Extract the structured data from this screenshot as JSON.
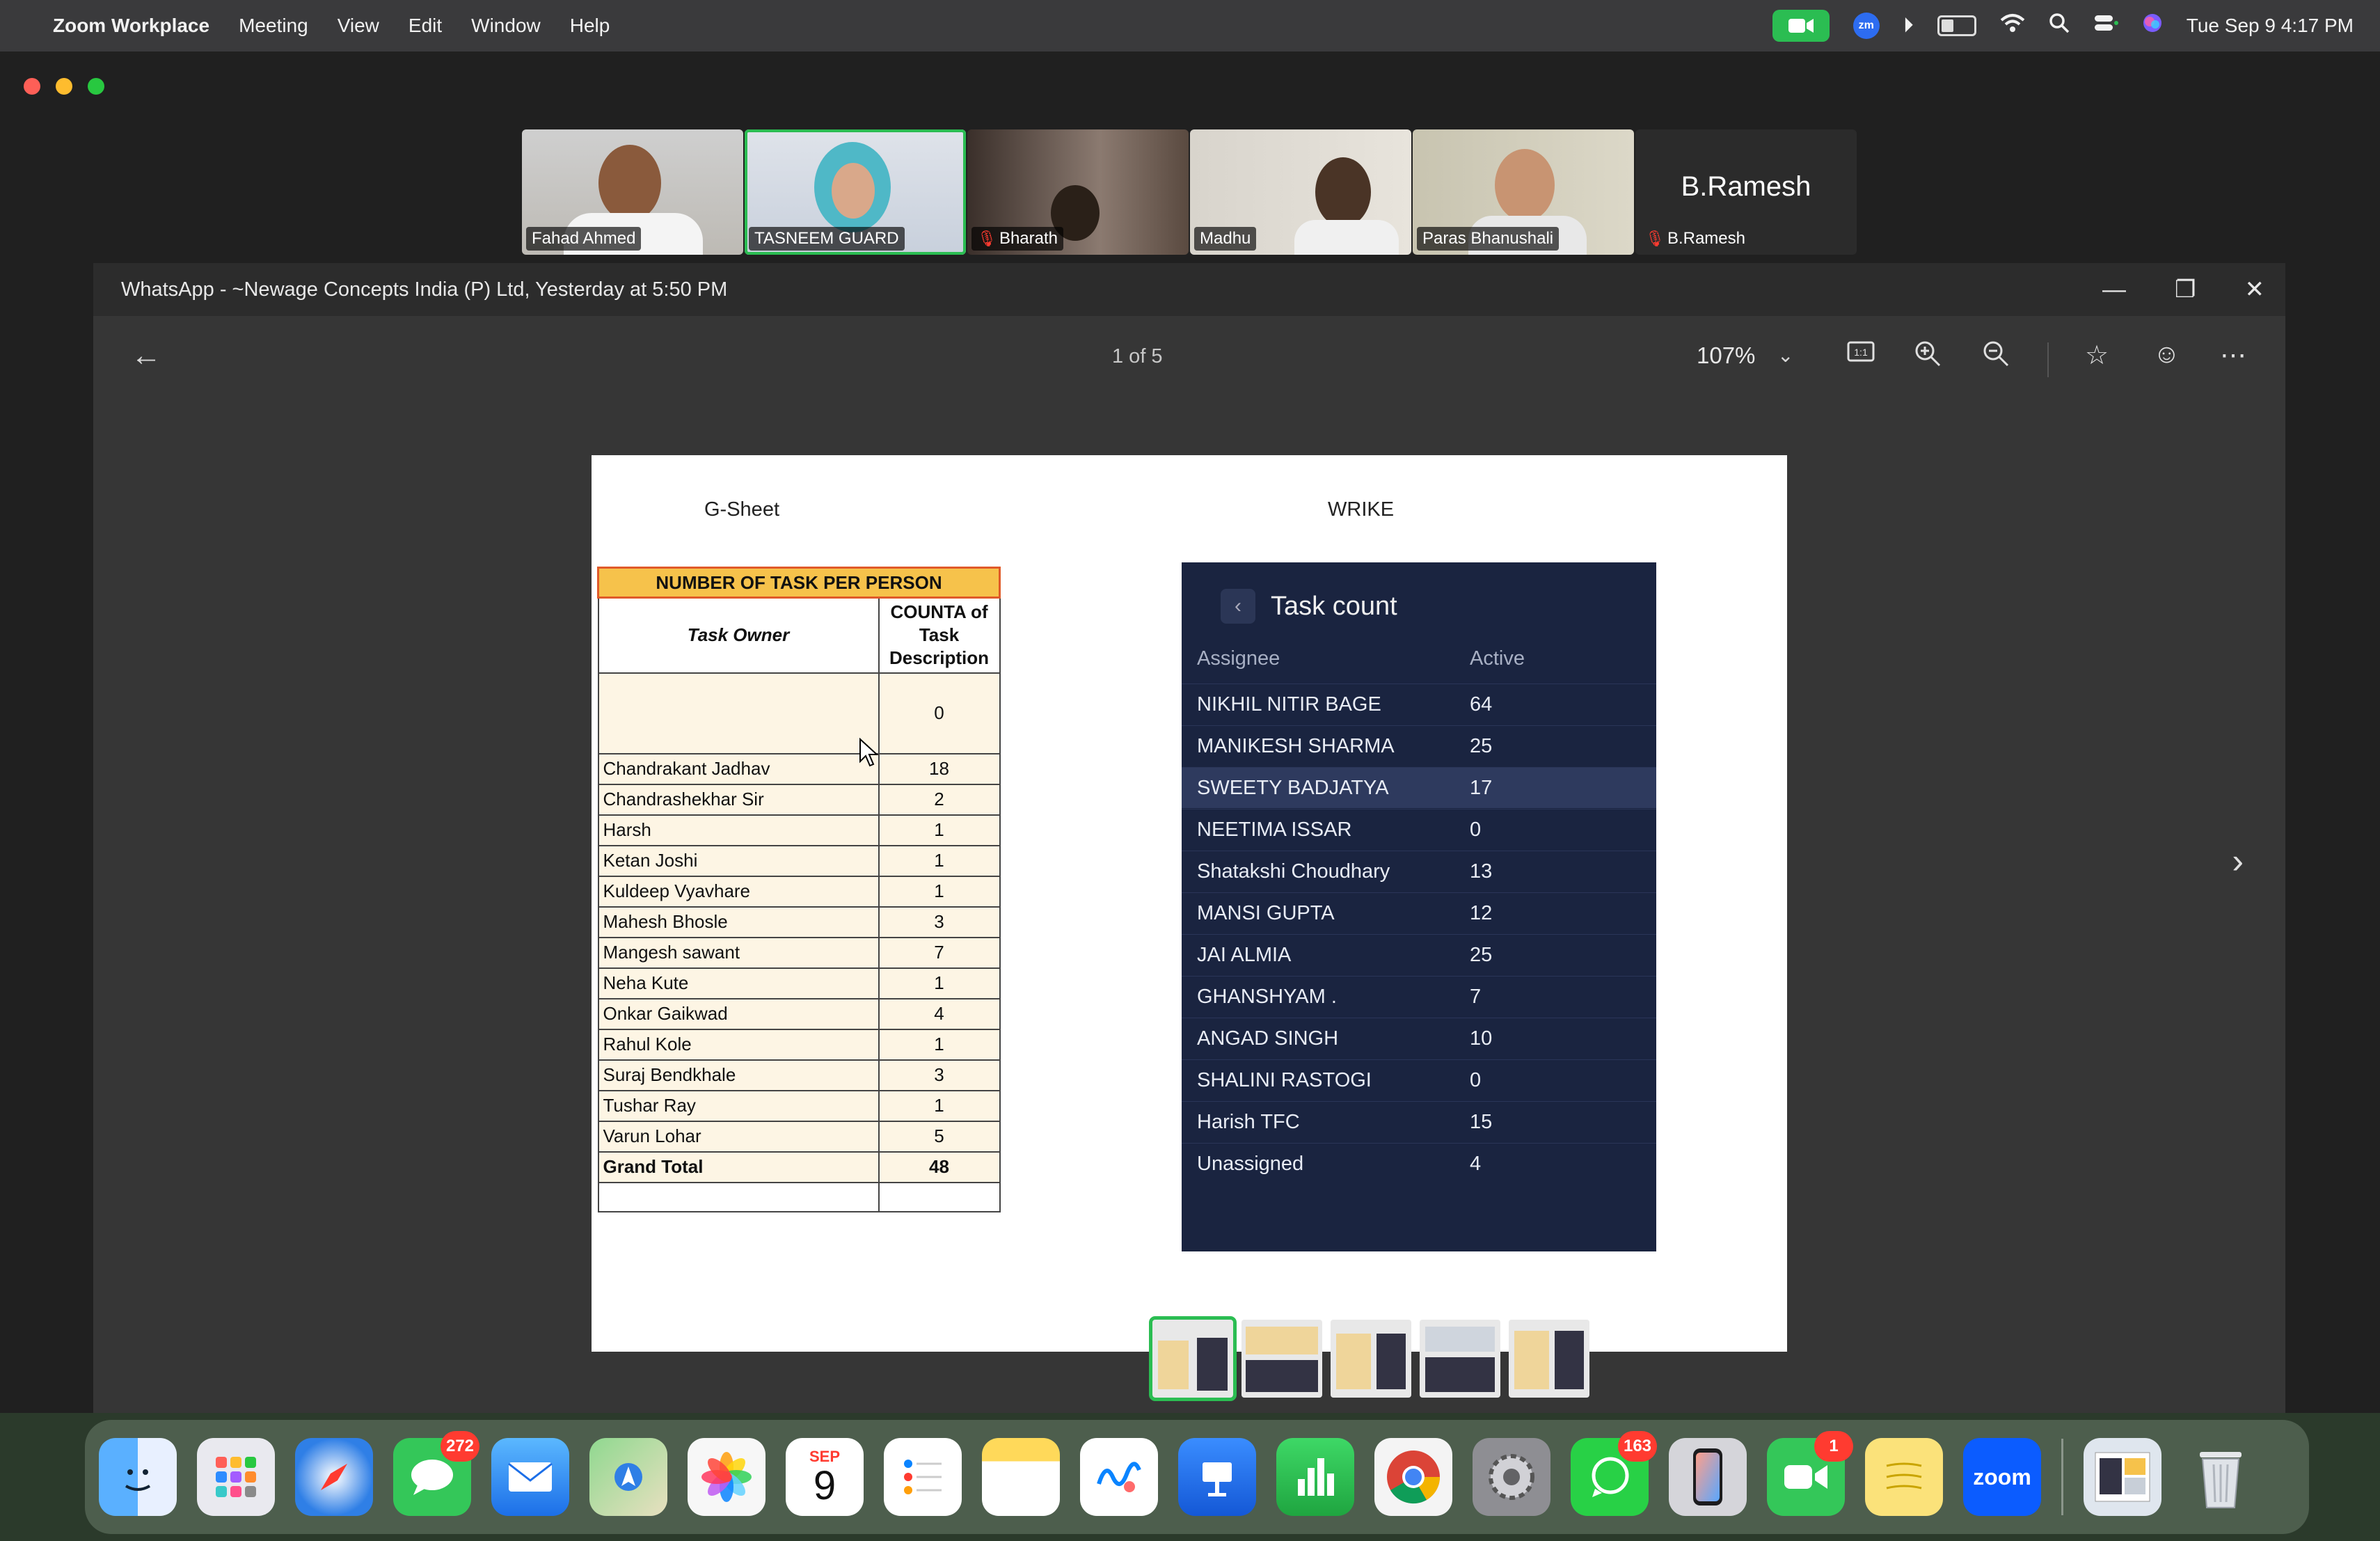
{
  "menubar": {
    "app": "Zoom Workplace",
    "menus": [
      "Meeting",
      "View",
      "Edit",
      "Window",
      "Help"
    ],
    "datetime": "Tue Sep 9  4:17 PM",
    "zm_label": "zm"
  },
  "participants": [
    {
      "name": "Fahad Ahmed",
      "muted": false
    },
    {
      "name": "TASNEEM  GUARD",
      "muted": false,
      "active": true
    },
    {
      "name": "Bharath",
      "muted": true
    },
    {
      "name": "Madhu",
      "muted": false
    },
    {
      "name": "Paras Bhanushali",
      "muted": false
    },
    {
      "name": "B.Ramesh",
      "muted": true,
      "display": "B.Ramesh"
    }
  ],
  "viewer": {
    "title": "WhatsApp - ~Newage Concepts India (P) Ltd, Yesterday at 5:50 PM",
    "page_indicator": "1 of 5",
    "zoom": "107%"
  },
  "page": {
    "left_label": "G-Sheet",
    "right_label": "WRIKE",
    "gsheet": {
      "header": "NUMBER OF TASK PER PERSON",
      "col_owner": "Task Owner",
      "col_count": "COUNTA of Task Description",
      "blank_count": "0",
      "rows": [
        {
          "name": "Chandrakant Jadhav",
          "count": "18"
        },
        {
          "name": "Chandrashekhar Sir",
          "count": "2"
        },
        {
          "name": "Harsh",
          "count": "1"
        },
        {
          "name": "Ketan Joshi",
          "count": "1"
        },
        {
          "name": "Kuldeep Vyavhare",
          "count": "1"
        },
        {
          "name": "Mahesh Bhosle",
          "count": "3"
        },
        {
          "name": "Mangesh sawant",
          "count": "7"
        },
        {
          "name": "Neha Kute",
          "count": "1"
        },
        {
          "name": "Onkar Gaikwad",
          "count": "4"
        },
        {
          "name": "Rahul Kole",
          "count": "1"
        },
        {
          "name": "Suraj Bendkhale",
          "count": "3"
        },
        {
          "name": "Tushar Ray",
          "count": "1"
        },
        {
          "name": "Varun Lohar",
          "count": "5"
        }
      ],
      "total_label": "Grand Total",
      "total_value": "48"
    },
    "wrike": {
      "title": "Task count",
      "col_assignee": "Assignee",
      "col_active": "Active",
      "rows": [
        {
          "name": "NIKHIL NITIR BAGE",
          "active": "64"
        },
        {
          "name": "MANIKESH SHARMA",
          "active": "25"
        },
        {
          "name": "SWEETY BADJATYA",
          "active": "17",
          "highlight": true
        },
        {
          "name": "NEETIMA ISSAR",
          "active": "0"
        },
        {
          "name": "Shatakshi Choudhary",
          "active": "13"
        },
        {
          "name": "MANSI GUPTA",
          "active": "12"
        },
        {
          "name": "JAI ALMIA",
          "active": "25"
        },
        {
          "name": "GHANSHYAM .",
          "active": "7"
        },
        {
          "name": "ANGAD SINGH",
          "active": "10"
        },
        {
          "name": "SHALINI RASTOGI",
          "active": "0"
        },
        {
          "name": "Harish TFC",
          "active": "15"
        },
        {
          "name": "Unassigned",
          "active": "4"
        }
      ]
    }
  },
  "dock": {
    "apps": [
      {
        "name": "Finder",
        "color": "#3b8ff0"
      },
      {
        "name": "Launchpad",
        "color": "#e0e0e8"
      },
      {
        "name": "Safari",
        "color": "#2f7fe6"
      },
      {
        "name": "Messages",
        "color": "#34c759",
        "badge": "272"
      },
      {
        "name": "Mail",
        "color": "#2f86f0"
      },
      {
        "name": "Maps",
        "color": "#5ec16b"
      },
      {
        "name": "Photos",
        "color": "#f4f4f4"
      },
      {
        "name": "Calendar",
        "color": "#ffffff",
        "month": "SEP",
        "day": "9"
      },
      {
        "name": "Reminders",
        "color": "#ffffff"
      },
      {
        "name": "Notes",
        "color": "#fbe27a"
      },
      {
        "name": "Freeform",
        "color": "#ffffff"
      },
      {
        "name": "Keynote",
        "color": "#2a7ef5"
      },
      {
        "name": "Numbers",
        "color": "#2fb94f"
      },
      {
        "name": "Chrome",
        "color": "#f4f4f4"
      },
      {
        "name": "System Settings",
        "color": "#8e8e93"
      },
      {
        "name": "WhatsApp",
        "color": "#28d146",
        "badge": "163"
      },
      {
        "name": "iPhone Mirroring",
        "color": "#c9c9d0"
      },
      {
        "name": "FaceTime",
        "color": "#34c759",
        "badge": "1"
      },
      {
        "name": "Stickies",
        "color": "#fbe27a"
      },
      {
        "name": "Zoom",
        "color": "#0b5cff",
        "label": "zoom"
      },
      {
        "name": "Document Preview",
        "color": "#dfe6ee"
      },
      {
        "name": "Trash",
        "color": "#d9dde2"
      }
    ]
  }
}
